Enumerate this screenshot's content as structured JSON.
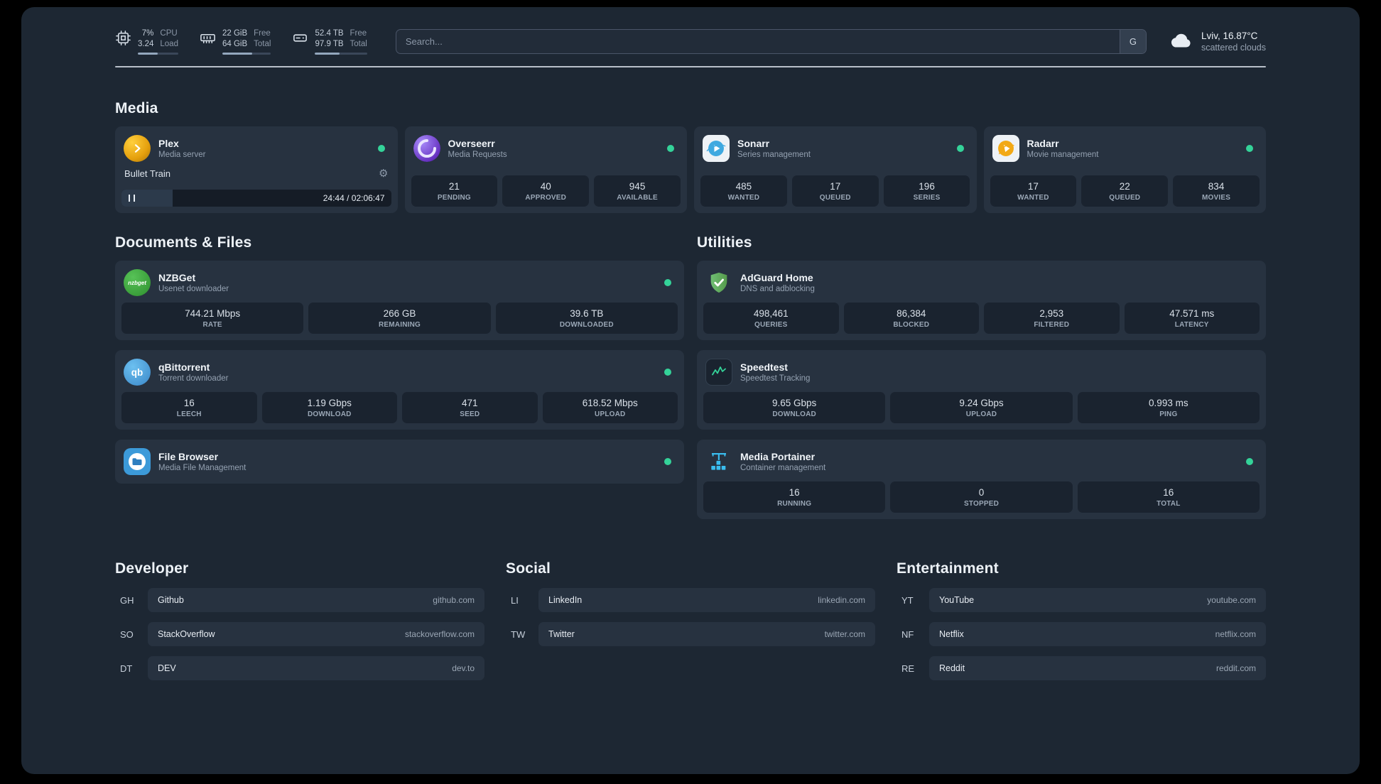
{
  "theme": {
    "status_online_color": "#34d399",
    "page_background": "#1d2733",
    "card_background": "#273240",
    "tile_background": "#1a232f"
  },
  "icons": {
    "gear": "⚙",
    "nzbget_label": "nzbget",
    "qbittorrent_label": "qb"
  },
  "topbar": {
    "cpu": {
      "icon": "cpu-icon",
      "values": [
        "7%",
        "3.24"
      ],
      "labels": [
        "CPU",
        "Load"
      ],
      "percent": 50
    },
    "memory": {
      "icon": "memory-icon",
      "values": [
        "22 GiB",
        "64 GiB"
      ],
      "labels": [
        "Free",
        "Total"
      ],
      "percent": 62
    },
    "disk": {
      "icon": "disk-icon",
      "values": [
        "52.4 TB",
        "97.9 TB"
      ],
      "labels": [
        "Free",
        "Total"
      ],
      "percent": 47
    },
    "search": {
      "placeholder": "Search...",
      "provider_label": "G"
    },
    "weather": {
      "icon": "cloud-icon",
      "location": "Lviv, 16.87°C",
      "condition": "scattered clouds"
    }
  },
  "sections": {
    "media": {
      "title": "Media",
      "plex": {
        "icon": "plex-icon",
        "name": "Plex",
        "description": "Media server",
        "player": {
          "track": "Bullet Train",
          "time": "24:44 / 02:06:47",
          "progress_percent": 19
        }
      },
      "overseerr": {
        "icon": "overseerr-icon",
        "name": "Overseerr",
        "description": "Media Requests",
        "stats": [
          {
            "value": "21",
            "label": "PENDING"
          },
          {
            "value": "40",
            "label": "APPROVED"
          },
          {
            "value": "945",
            "label": "AVAILABLE"
          }
        ]
      },
      "sonarr": {
        "icon": "sonarr-icon",
        "name": "Sonarr",
        "description": "Series management",
        "stats": [
          {
            "value": "485",
            "label": "WANTED"
          },
          {
            "value": "17",
            "label": "QUEUED"
          },
          {
            "value": "196",
            "label": "SERIES"
          }
        ]
      },
      "radarr": {
        "icon": "radarr-icon",
        "name": "Radarr",
        "description": "Movie management",
        "stats": [
          {
            "value": "17",
            "label": "WANTED"
          },
          {
            "value": "22",
            "label": "QUEUED"
          },
          {
            "value": "834",
            "label": "MOVIES"
          }
        ]
      }
    },
    "documents": {
      "title": "Documents & Files",
      "nzbget": {
        "icon": "nzbget-icon",
        "name": "NZBGet",
        "description": "Usenet downloader",
        "stats": [
          {
            "value": "744.21 Mbps",
            "label": "RATE"
          },
          {
            "value": "266 GB",
            "label": "REMAINING"
          },
          {
            "value": "39.6 TB",
            "label": "DOWNLOADED"
          }
        ]
      },
      "qbittorrent": {
        "icon": "qbittorrent-icon",
        "name": "qBittorrent",
        "description": "Torrent downloader",
        "stats": [
          {
            "value": "16",
            "label": "LEECH"
          },
          {
            "value": "1.19 Gbps",
            "label": "DOWNLOAD"
          },
          {
            "value": "471",
            "label": "SEED"
          },
          {
            "value": "618.52 Mbps",
            "label": "UPLOAD"
          }
        ]
      },
      "filebrowser": {
        "icon": "filebrowser-icon",
        "name": "File Browser",
        "description": "Media File Management"
      }
    },
    "utilities": {
      "title": "Utilities",
      "adguard": {
        "icon": "adguard-icon",
        "name": "AdGuard Home",
        "description": "DNS and adblocking",
        "stats": [
          {
            "value": "498,461",
            "label": "QUERIES"
          },
          {
            "value": "86,384",
            "label": "BLOCKED"
          },
          {
            "value": "2,953",
            "label": "FILTERED"
          },
          {
            "value": "47.571 ms",
            "label": "LATENCY"
          }
        ]
      },
      "speedtest": {
        "icon": "speedtest-icon",
        "name": "Speedtest",
        "description": "Speedtest Tracking",
        "stats": [
          {
            "value": "9.65 Gbps",
            "label": "DOWNLOAD"
          },
          {
            "value": "9.24 Gbps",
            "label": "UPLOAD"
          },
          {
            "value": "0.993 ms",
            "label": "PING"
          }
        ]
      },
      "portainer": {
        "icon": "portainer-icon",
        "name": "Media Portainer",
        "description": "Container management",
        "stats": [
          {
            "value": "16",
            "label": "RUNNING"
          },
          {
            "value": "0",
            "label": "STOPPED"
          },
          {
            "value": "16",
            "label": "TOTAL"
          }
        ]
      }
    }
  },
  "bookmarks": {
    "developer": {
      "title": "Developer",
      "items": [
        {
          "abbr": "GH",
          "name": "Github",
          "url": "github.com"
        },
        {
          "abbr": "SO",
          "name": "StackOverflow",
          "url": "stackoverflow.com"
        },
        {
          "abbr": "DT",
          "name": "DEV",
          "url": "dev.to"
        }
      ]
    },
    "social": {
      "title": "Social",
      "items": [
        {
          "abbr": "LI",
          "name": "LinkedIn",
          "url": "linkedin.com"
        },
        {
          "abbr": "TW",
          "name": "Twitter",
          "url": "twitter.com"
        }
      ]
    },
    "entertainment": {
      "title": "Entertainment",
      "items": [
        {
          "abbr": "YT",
          "name": "YouTube",
          "url": "youtube.com"
        },
        {
          "abbr": "NF",
          "name": "Netflix",
          "url": "netflix.com"
        },
        {
          "abbr": "RE",
          "name": "Reddit",
          "url": "reddit.com"
        }
      ]
    }
  }
}
